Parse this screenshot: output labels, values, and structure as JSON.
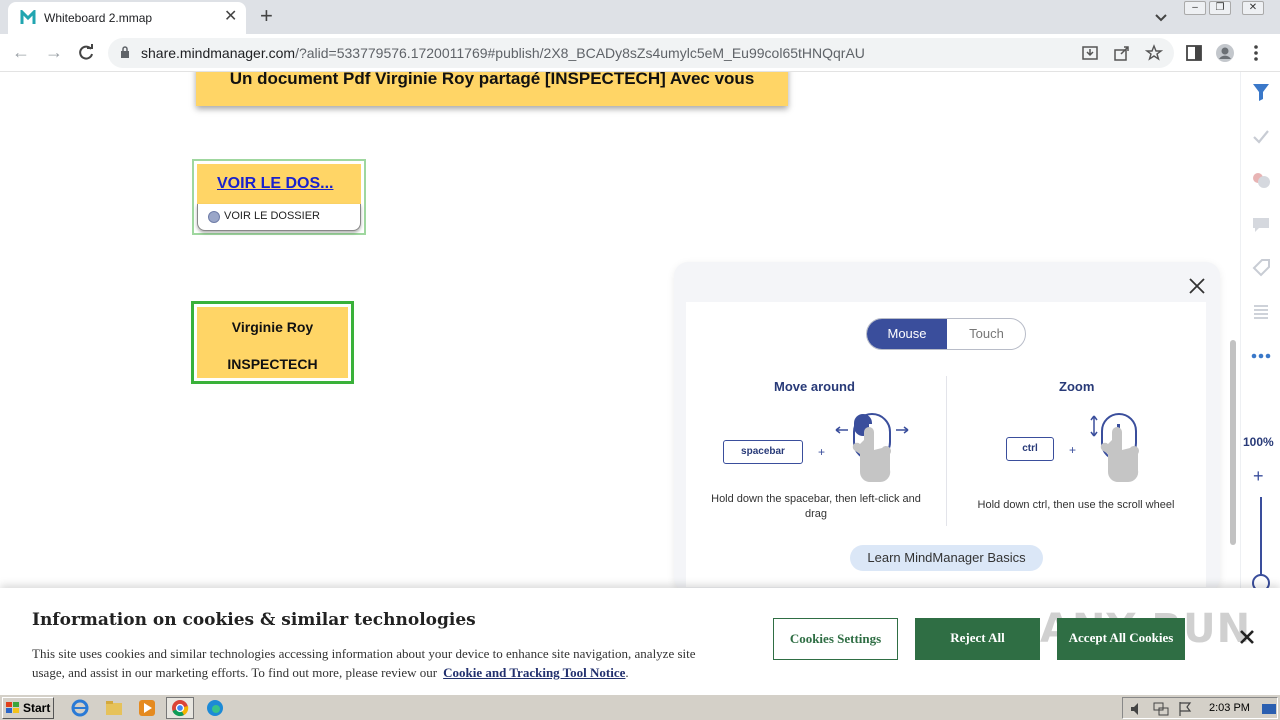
{
  "browser": {
    "tab_title": "Whiteboard 2.mmap",
    "url_host": "share.mindmanager.com",
    "url_rest": "/?alid=533779576.1720011769#publish/2X8_BCADy8sZs4umylc5eM_Eu99col65tHNQqrAU"
  },
  "canvas": {
    "banner_text": "Un document Pdf Virginie Roy partagé [INSPECTECH] Avec vous",
    "link_node_title": "VOIR LE DOS...",
    "link_node_sub": "VOIR LE DOSSIER",
    "person_node_line1": "Virginie Roy",
    "person_node_line2": "INSPECTECH"
  },
  "help_panel": {
    "tabs": {
      "active": "Mouse",
      "inactive": "Touch"
    },
    "move": {
      "title": "Move around",
      "key": "spacebar",
      "plus": "+",
      "caption": "Hold down the spacebar, then left-click and drag"
    },
    "zoom": {
      "title": "Zoom",
      "key": "ctrl",
      "plus": "+",
      "caption": "Hold down ctrl, then use the scroll wheel"
    },
    "learn_button": "Learn MindManager Basics"
  },
  "sidebar": {
    "zoom_level": "100%",
    "zoom_plus": "+"
  },
  "cookie_banner": {
    "title": "Information on cookies & similar technologies",
    "body": "This site uses cookies and similar technologies accessing information about your device to enhance site navigation, analyze site usage, and assist in our marketing efforts. To find out more, please review our",
    "link": "Cookie and Tracking Tool Notice",
    "period": ".",
    "settings_button": "Cookies Settings",
    "reject_button": "Reject All",
    "accept_button": "Accept All Cookies",
    "watermark": "ANY RUN"
  },
  "taskbar": {
    "start_label": "Start",
    "clock": "2:03 PM"
  },
  "colors": {
    "node_yellow": "#ffd566",
    "mindmanager_blue": "#3a4e9c",
    "cookie_green": "#2f6e44",
    "link_blue": "#1a22cc"
  },
  "icons": {
    "tab_favicon": "mindmanager-logo-icon",
    "sidebar": [
      "filter-icon",
      "check-icon",
      "task-icon",
      "comment-icon",
      "tag-icon",
      "list-icon",
      "more-icon"
    ]
  }
}
